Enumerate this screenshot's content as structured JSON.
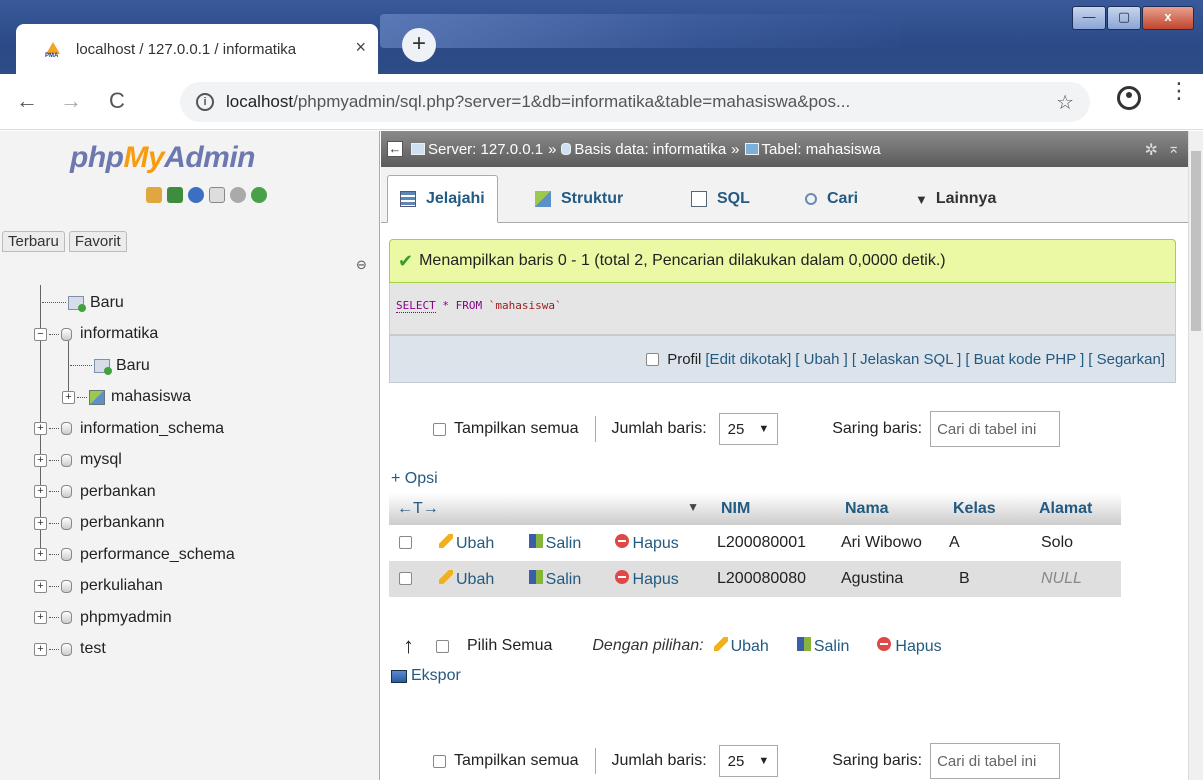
{
  "browser": {
    "tab_title": "localhost / 127.0.0.1 / informatika",
    "tab_close": "×",
    "new_tab": "+",
    "window_buttons": {
      "minimize": "—",
      "maximize": "▢",
      "close": "x"
    },
    "nav": {
      "back": "←",
      "forward": "→",
      "reload": "C"
    },
    "url_host": "localhost",
    "url_path": "/phpmyadmin/sql.php?server=1&db=informatika&table=mahasiswa&pos...",
    "info_glyph": "i",
    "bookmark": "☆",
    "menu": "⋮"
  },
  "sidebar": {
    "logo_php": "php",
    "logo_my": "My",
    "logo_admin": "Admin",
    "tabs": [
      "Terbaru",
      "Favorit"
    ],
    "link_icon": "⊖",
    "tree": [
      {
        "label": "Baru",
        "type": "new",
        "level": 0
      },
      {
        "label": "informatika",
        "type": "db",
        "level": 0,
        "expander": "−"
      },
      {
        "label": "Baru",
        "type": "new",
        "level": 1
      },
      {
        "label": "mahasiswa",
        "type": "table",
        "level": 1,
        "expander": "+"
      },
      {
        "label": "information_schema",
        "type": "db",
        "level": 0,
        "expander": "+"
      },
      {
        "label": "mysql",
        "type": "db",
        "level": 0,
        "expander": "+"
      },
      {
        "label": "perbankan",
        "type": "db",
        "level": 0,
        "expander": "+"
      },
      {
        "label": "perbankann",
        "type": "db",
        "level": 0,
        "expander": "+"
      },
      {
        "label": "performance_schema",
        "type": "db",
        "level": 0,
        "expander": "+"
      },
      {
        "label": "perkuliahan",
        "type": "db",
        "level": 0,
        "expander": "+"
      },
      {
        "label": "phpmyadmin",
        "type": "db",
        "level": 0,
        "expander": "+"
      },
      {
        "label": "test",
        "type": "db",
        "level": 0,
        "expander": "+"
      }
    ]
  },
  "breadcrumb": {
    "collapse": "←",
    "server": "Server: 127.0.0.1",
    "sep": "»",
    "database": "Basis data: informatika",
    "table": "Tabel: mahasiswa",
    "gear": "✲",
    "up": "⌅"
  },
  "tabs": {
    "browse": "Jelajahi",
    "structure": "Struktur",
    "sql": "SQL",
    "search": "Cari",
    "more": "Lainnya",
    "more_arrow": "▼"
  },
  "message": {
    "check": "✔",
    "text": "Menampilkan baris 0 - 1 (total 2, Pencarian dilakukan dalam 0,0000 detik.)"
  },
  "sql": {
    "select": "SELECT",
    "rest_kw": " * FROM ",
    "table": "`mahasiswa`"
  },
  "sql_links": {
    "profile": "Profil",
    "edit_inline": "[Edit dikotak]",
    "edit": "[ Ubah ]",
    "explain": "[ Jelaskan SQL ]",
    "php_code": "[ Buat kode PHP ]",
    "refresh": "[ Segarkan]"
  },
  "navbar": {
    "show_all": "Tampilkan semua",
    "rows_label": "Jumlah baris:",
    "rows_value": "25",
    "rows_arrow": "▼",
    "filter_label": "Saring baris:",
    "filter_placeholder": "Cari di tabel ini"
  },
  "options_link": "+ Opsi",
  "table": {
    "arrows": "←T→",
    "sort_arrow": "▼",
    "columns": [
      "NIM",
      "Nama",
      "Kelas",
      "Alamat"
    ],
    "action_labels": {
      "edit": "Ubah",
      "copy": "Salin",
      "delete": "Hapus"
    },
    "rows": [
      {
        "nim": "L200080001",
        "nama": "Ari Wibowo",
        "kelas": "A",
        "alamat": "Solo"
      },
      {
        "nim": "L200080080",
        "nama": "Agustina",
        "kelas": "B",
        "alamat": "NULL"
      }
    ]
  },
  "bulk": {
    "arrow": "↑",
    "check_all": "Pilih Semua",
    "with_selected": "Dengan pilihan:",
    "edit": "Ubah",
    "copy": "Salin",
    "delete": "Hapus",
    "export": "Ekspor"
  }
}
